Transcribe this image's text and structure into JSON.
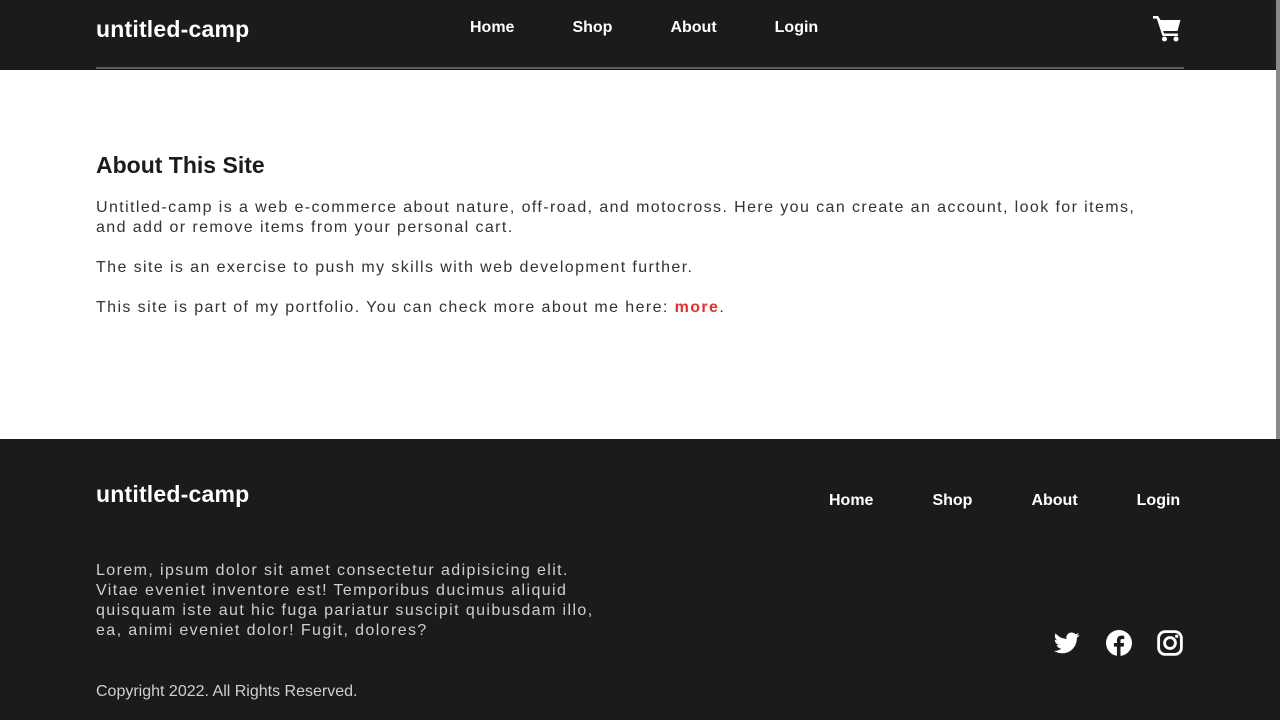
{
  "header": {
    "brand": "untitled-camp",
    "nav": [
      "Home",
      "Shop",
      "About",
      "Login"
    ],
    "cart_icon": "shopping-cart-icon"
  },
  "main": {
    "title": "About This Site",
    "paragraph1": "Untitled-camp is a web e-commerce about nature, off-road, and motocross. Here you can create an account, look for items, and add or remove items from your personal cart.",
    "paragraph2": "The site is an exercise to push my skills with web development further.",
    "paragraph3_prefix": "This site is part of my portfolio. You can check more about me here: ",
    "paragraph3_link": "more",
    "paragraph3_suffix": "."
  },
  "footer": {
    "brand": "untitled-camp",
    "nav": [
      "Home",
      "Shop",
      "About",
      "Login"
    ],
    "blurb": "Lorem, ipsum dolor sit amet consectetur adipisicing elit. Vitae eveniet inventore est! Temporibus ducimus aliquid quisquam iste aut hic fuga pariatur suscipit quibusdam illo, ea, animi eveniet dolor! Fugit, dolores?",
    "copyright": "Copyright 2022. All Rights Reserved.",
    "social_icons": [
      "twitter-icon",
      "facebook-icon",
      "instagram-icon"
    ]
  },
  "colors": {
    "dark": "#1c1b1b",
    "accent": "#e52e2e",
    "text": "#333333",
    "footer_text": "#cfcfcf"
  }
}
